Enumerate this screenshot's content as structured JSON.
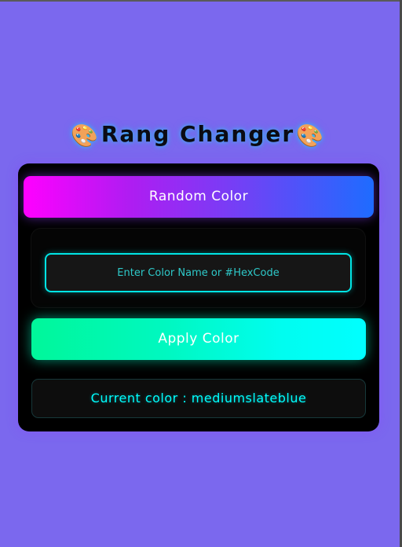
{
  "app": {
    "title": "Rang Changer",
    "title_icon": "🎨"
  },
  "random_button": {
    "label": "Random Color"
  },
  "color_input": {
    "placeholder": "Enter Color Name or #HexCode",
    "value": ""
  },
  "apply_button": {
    "label": "Apply Color"
  },
  "current_color": {
    "text": "Current color : mediumslateblue",
    "value": "mediumslateblue"
  },
  "colors": {
    "page_background": "#7b68ee",
    "card_background": "#000000",
    "accent_cyan": "#00ffff",
    "random_gradient_start": "#ff00ff",
    "random_gradient_end": "#1e6cff",
    "apply_gradient_start": "#00f79a",
    "apply_gradient_end": "#00ffff"
  }
}
